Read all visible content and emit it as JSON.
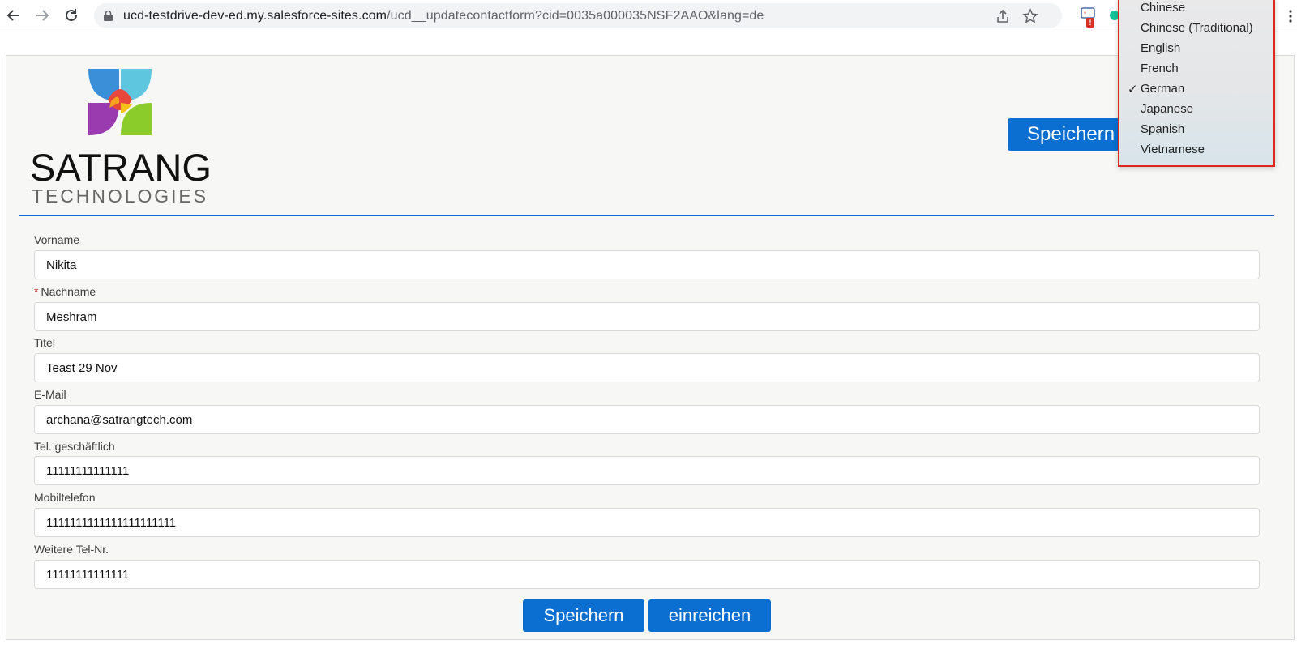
{
  "browser": {
    "url_host": "ucd-testdrive-dev-ed.my.salesforce-sites.com",
    "url_path": "/ucd__updatecontactform?cid=0035a000035NSF2AAO&lang=de",
    "ext_badge": "!"
  },
  "logo": {
    "name": "SATRANG",
    "tagline": "TECHNOLOGIES"
  },
  "header": {
    "save_label": "Speichern"
  },
  "form": {
    "fields": [
      {
        "label": "Vorname",
        "value": "Nikita",
        "required": false
      },
      {
        "label": "Nachname",
        "value": "Meshram",
        "required": true
      },
      {
        "label": "Titel",
        "value": "Teast 29 Nov",
        "required": false
      },
      {
        "label": "E-Mail",
        "value": "archana@satrangtech.com",
        "required": false
      },
      {
        "label": "Tel. geschäftlich",
        "value": "11111111111111",
        "required": false
      },
      {
        "label": "Mobiltelefon",
        "value": "1111111111111111111111",
        "required": false
      },
      {
        "label": "Weitere Tel-Nr.",
        "value": "11111111111111",
        "required": false
      }
    ],
    "required_marker": "*",
    "save_label": "Speichern",
    "submit_label": "einreichen"
  },
  "language_menu": {
    "items": [
      "Chinese",
      "Chinese (Traditional)",
      "English",
      "French",
      "German",
      "Japanese",
      "Spanish",
      "Vietnamese"
    ],
    "selected": "German",
    "check_mark": "✓"
  },
  "colors": {
    "primary_button": "#0a6fd1",
    "divider": "#1a66d2",
    "highlight_border": "#e0271e",
    "required": "#c23934"
  }
}
